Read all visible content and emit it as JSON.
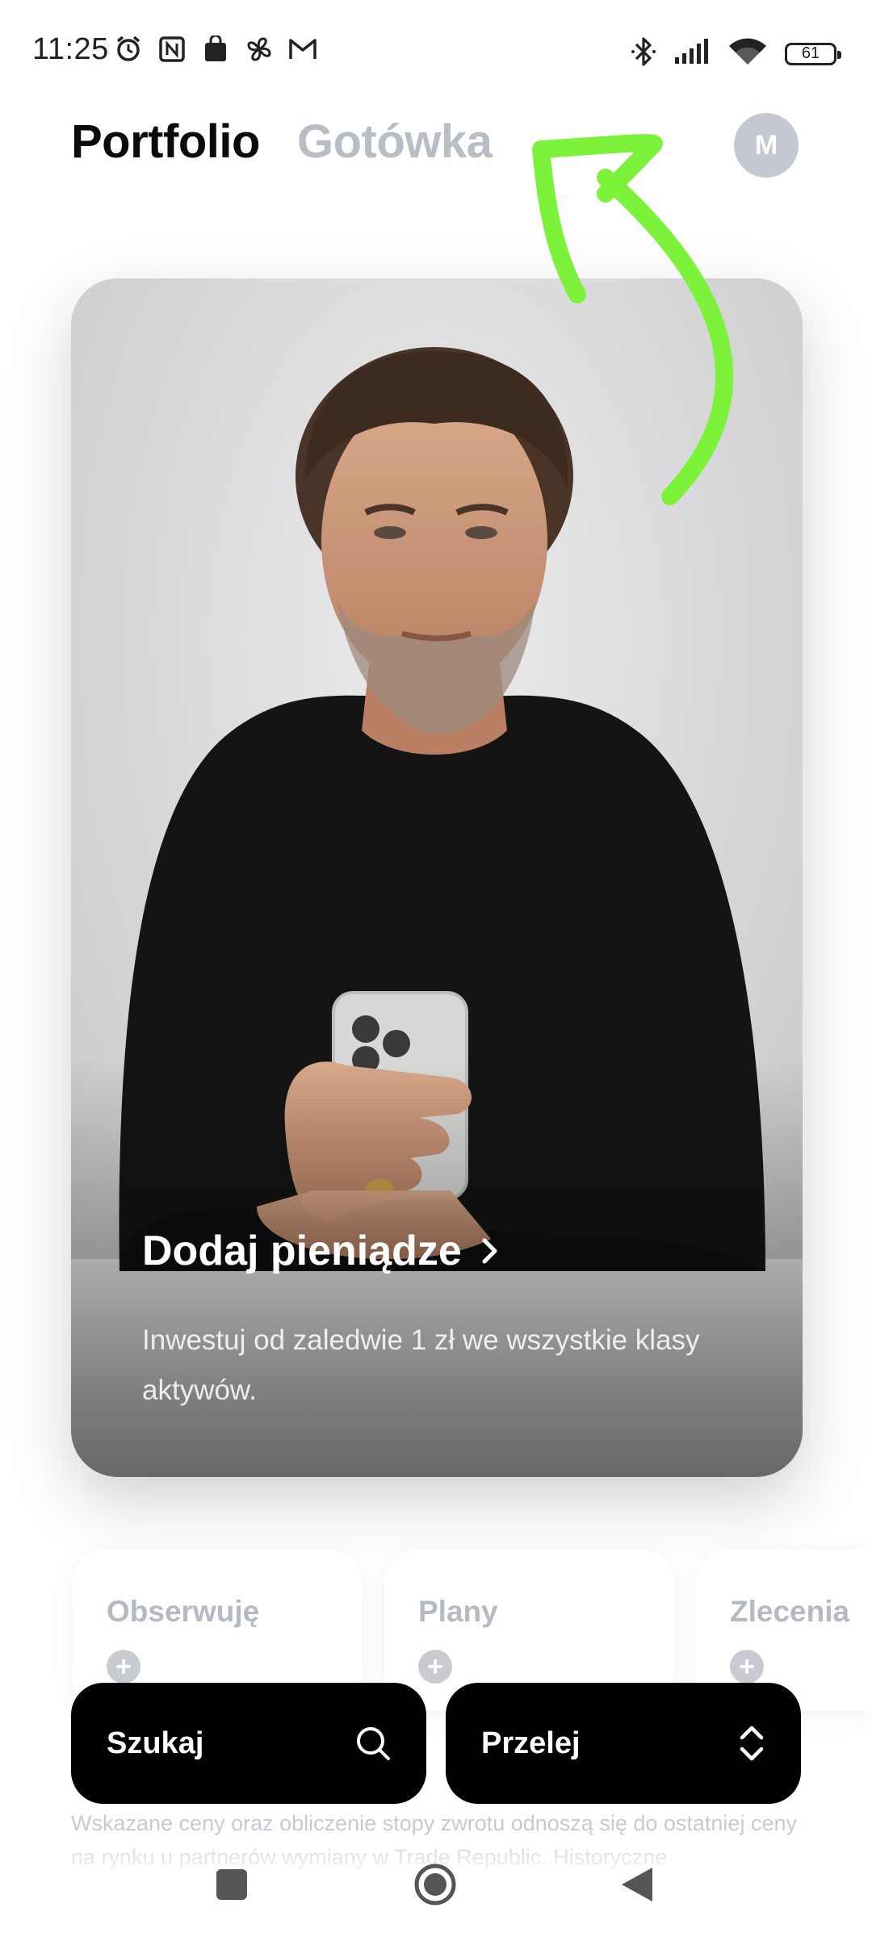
{
  "status_bar": {
    "time": "11:25",
    "battery": "61",
    "left_icons": [
      "alarm-icon",
      "nfc-icon",
      "shopping-bag-icon",
      "fan-icon",
      "gmail-icon"
    ],
    "right_icons": [
      "bluetooth-icon",
      "signal-icon",
      "wifi-icon",
      "battery-icon"
    ]
  },
  "header": {
    "tab_active": "Portfolio",
    "tab_inactive": "Gotówka",
    "avatar_initial": "M"
  },
  "promo": {
    "title": "Dodaj pieniądze",
    "subtitle": "Inwestuj od zaledwie 1 zł we wszystkie klasy aktywów."
  },
  "tiles": [
    {
      "label": "Obserwuję"
    },
    {
      "label": "Plany"
    },
    {
      "label": "Zlecenia"
    }
  ],
  "actions": {
    "search_label": "Szukaj",
    "transfer_label": "Przelej"
  },
  "disclaimer": "Wskazane ceny oraz obliczenie stopy zwrotu odnoszą się do ostatniej ceny na rynku u partnerów wymiany w Trade Republic. Historyczne",
  "colors": {
    "accent_annotation": "#7cf33a",
    "inactive_text": "#b9bec6",
    "button_bg": "#000000"
  }
}
